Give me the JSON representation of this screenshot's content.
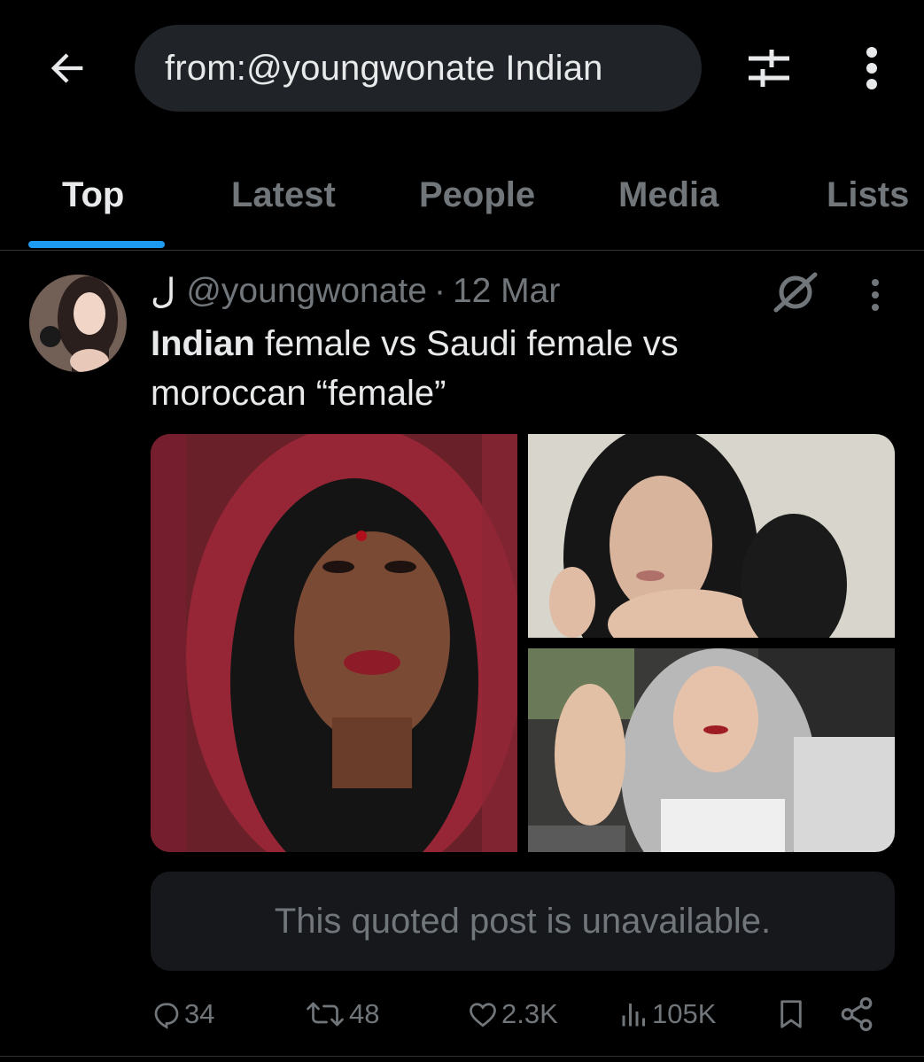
{
  "search": {
    "query": "from:@youngwonate Indian"
  },
  "icons": {
    "back": "back-arrow-icon",
    "filter": "filter-sliders-icon",
    "more": "more-vertical-icon",
    "grok": "grok-icon",
    "reply": "reply-icon",
    "repost": "repost-icon",
    "like": "heart-icon",
    "views": "views-chart-icon",
    "bookmark": "bookmark-icon",
    "share": "share-icon"
  },
  "tabs": [
    {
      "label": "Top",
      "active": true
    },
    {
      "label": "Latest",
      "active": false
    },
    {
      "label": "People",
      "active": false
    },
    {
      "label": "Media",
      "active": false
    },
    {
      "label": "Lists",
      "active": false
    }
  ],
  "post": {
    "display_name": "ل",
    "handle": "@youngwonate",
    "separator": "·",
    "date": "12 Mar",
    "text_bold": "Indian",
    "text_rest_line1": " female vs Saudi female vs",
    "text_line2": "moroccan “female”",
    "quoted": "This quoted post is unavailable.",
    "stats": {
      "replies": "34",
      "reposts": "48",
      "likes": "2.3K",
      "views": "105K"
    }
  },
  "colors": {
    "background": "#000000",
    "text_primary": "#e7e9ea",
    "text_secondary": "#71767b",
    "accent": "#1d9bf0",
    "search_bg": "#202327",
    "quote_bg": "#16181c",
    "divider": "#2f3336"
  }
}
